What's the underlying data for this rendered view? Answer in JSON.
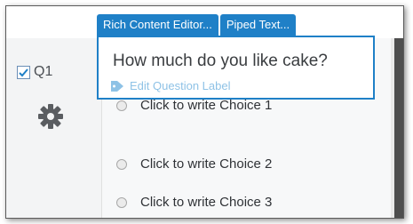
{
  "tabs": [
    "Rich Content Editor...",
    "Piped Text..."
  ],
  "question": {
    "id_label": "Q1",
    "selected": true,
    "text": "How much do you like cake?",
    "edit_label": "Edit Question Label"
  },
  "choices": [
    "Click to write Choice 1",
    "Click to write Choice 2",
    "Click to write Choice 3"
  ],
  "colors": {
    "accent": "#1f80c7",
    "label_link": "#8ec2e6"
  },
  "icons": {
    "settings": "gear-icon",
    "label": "tag-icon",
    "check": "checkmark-icon"
  }
}
